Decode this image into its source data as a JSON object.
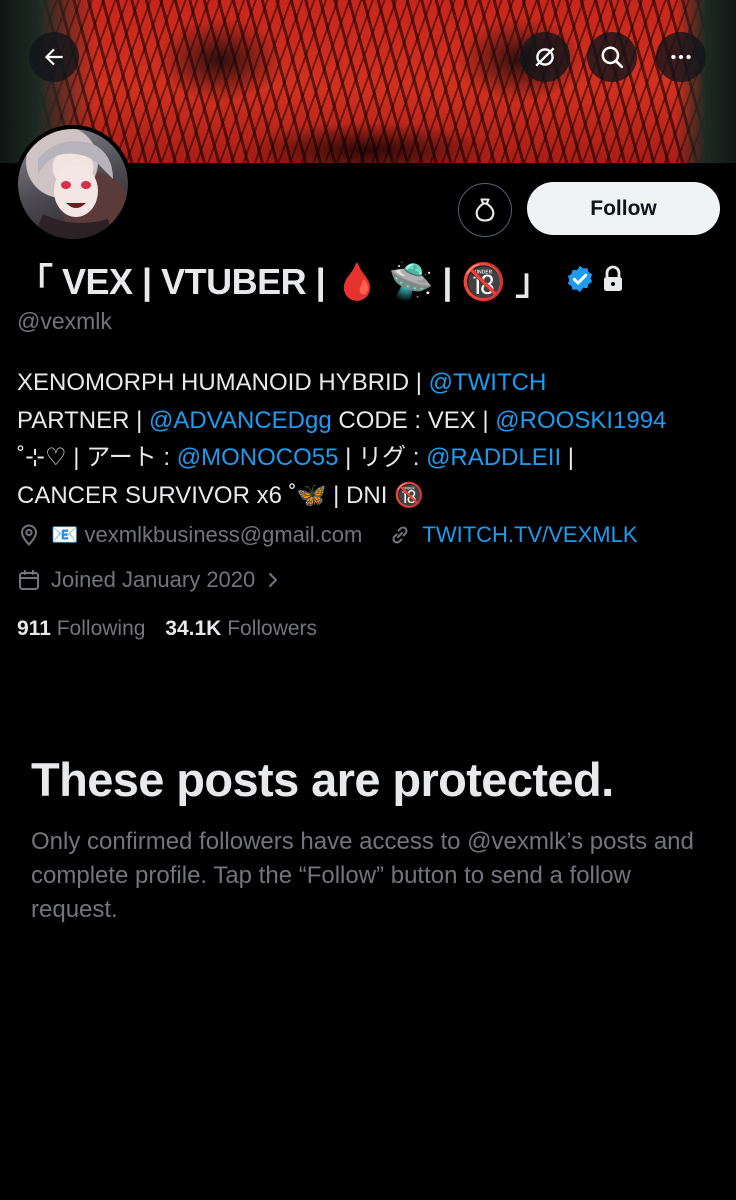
{
  "header": {
    "back_icon": "arrow-left-icon",
    "translate_icon": "slashed-circle-icon",
    "search_icon": "search-icon",
    "more_icon": "more-dots-icon"
  },
  "profile": {
    "display_name": "「 VEX | VTUBER | 🩸 🛸 | 🔞 」",
    "verified": true,
    "protected": true,
    "handle": "@vexmlk",
    "follow_label": "Follow",
    "bio": {
      "line1": {
        "t1": "XENOMORPH HUMANOID HYBRID | ",
        "m1": "@TWITCH"
      },
      "line2": {
        "t1": "PARTNER | ",
        "m1": "@ADVANCEDgg",
        "t2": " CODE : VEX | ",
        "m2": "@ROOSKI1994"
      },
      "line3": {
        "t1": "˚⊹♡ | アート : ",
        "m1": "@MONOCO55",
        "t2": " | リグ : ",
        "m2": "@RADDLEII",
        "t3": " |"
      },
      "line4": {
        "t1": "CANCER SURVIVOR x6 ˚🦋  | DNI 🔞"
      }
    },
    "location": "📧 vexmlkbusiness@gmail.com",
    "website": "TWITCH.TV/VEXMLK",
    "joined": "Joined January 2020",
    "following_count": "911",
    "following_label": "Following",
    "followers_count": "34.1K",
    "followers_label": "Followers"
  },
  "protected_notice": {
    "title": "These posts are protected.",
    "body": "Only confirmed followers have access to @vexmlk’s posts and complete profile. Tap the “Follow” button to send a follow request."
  },
  "colors": {
    "background": "#000000",
    "text_primary": "#e7e9ea",
    "text_secondary": "#71767b",
    "link": "#1d9bf0",
    "follow_button": "#eff3f4",
    "banner_red": "#d2301f"
  }
}
